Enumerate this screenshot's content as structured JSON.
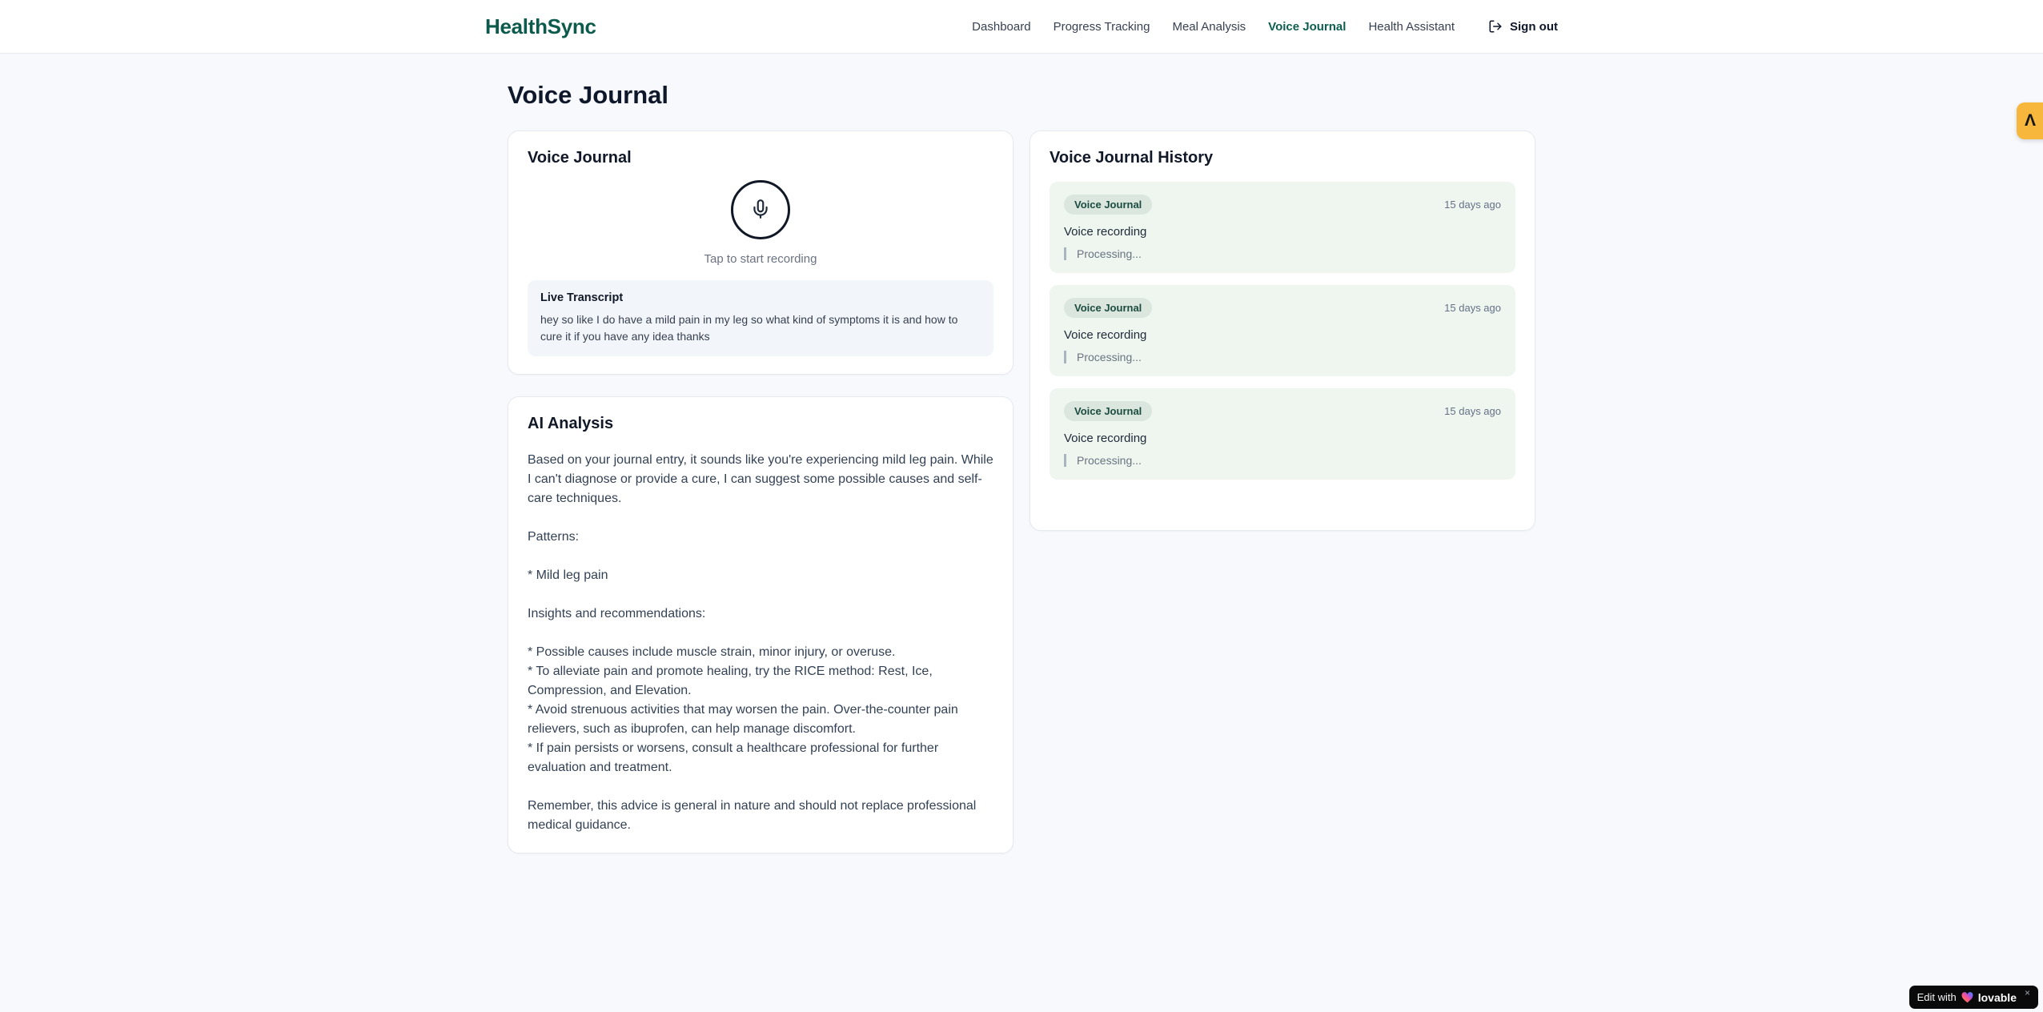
{
  "brand": {
    "name": "HealthSync"
  },
  "nav": {
    "items": [
      {
        "label": "Dashboard",
        "active": false
      },
      {
        "label": "Progress Tracking",
        "active": false
      },
      {
        "label": "Meal Analysis",
        "active": false
      },
      {
        "label": "Voice Journal",
        "active": true
      },
      {
        "label": "Health Assistant",
        "active": false
      }
    ],
    "sign_out": "Sign out"
  },
  "page": {
    "title": "Voice Journal"
  },
  "recorder_card": {
    "title": "Voice Journal",
    "tap_hint": "Tap to start recording",
    "live_transcript": {
      "title": "Live Transcript",
      "text": "hey so like I do have a mild pain in my leg so what kind of symptoms it is and how to cure it if you have any idea thanks"
    }
  },
  "analysis_card": {
    "title": "AI Analysis",
    "body": "Based on your journal entry, it sounds like you're experiencing mild leg pain. While I can't diagnose or provide a cure, I can suggest some possible causes and self-care techniques.\n\nPatterns:\n\n* Mild leg pain\n\nInsights and recommendations:\n\n* Possible causes include muscle strain, minor injury, or overuse.\n* To alleviate pain and promote healing, try the RICE method: Rest, Ice, Compression, and Elevation.\n* Avoid strenuous activities that may worsen the pain. Over-the-counter pain relievers, such as ibuprofen, can help manage discomfort.\n* If pain persists or worsens, consult a healthcare professional for further evaluation and treatment.\n\nRemember, this advice is general in nature and should not replace professional medical guidance."
  },
  "history_card": {
    "title": "Voice Journal History",
    "entries": [
      {
        "badge": "Voice Journal",
        "time": "15 days ago",
        "title": "Voice recording",
        "status": "Processing..."
      },
      {
        "badge": "Voice Journal",
        "time": "15 days ago",
        "title": "Voice recording",
        "status": "Processing..."
      },
      {
        "badge": "Voice Journal",
        "time": "15 days ago",
        "title": "Voice recording",
        "status": "Processing..."
      }
    ]
  },
  "floating": {
    "edit_badge": {
      "prefix": "Edit with",
      "brand": "lovable",
      "close": "×"
    },
    "side_button": {
      "icon": "lovable-mark"
    }
  },
  "colors": {
    "brand_green": "#0c5a4c",
    "active_nav": "#0e5e50",
    "entry_bg": "#eff6f0",
    "badge_bg": "#dbe7de",
    "badge_text": "#1c4c41",
    "side_button_amber": "#f6b73c",
    "edit_badge_black": "#0a0a0a",
    "page_bg": "#f7f9fc"
  }
}
